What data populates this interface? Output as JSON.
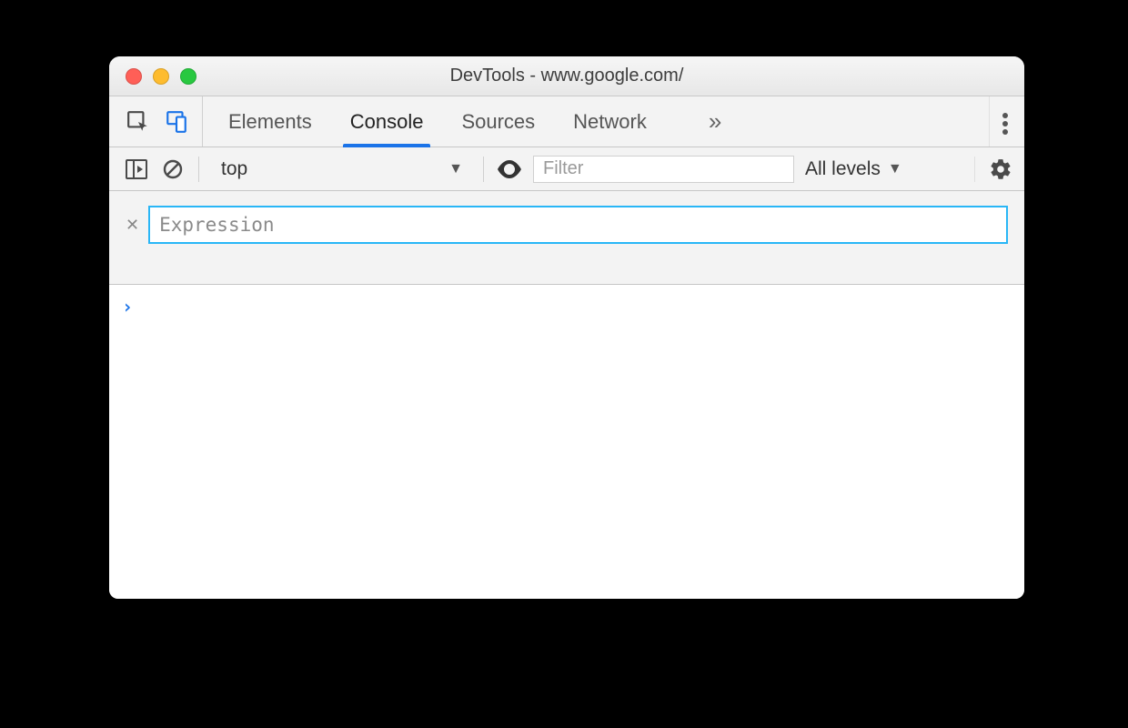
{
  "window": {
    "title": "DevTools - www.google.com/"
  },
  "tabs": {
    "items": [
      "Elements",
      "Console",
      "Sources",
      "Network"
    ],
    "active": "Console",
    "overflow_glyph": "»"
  },
  "toolbar": {
    "context": "top",
    "filter_placeholder": "Filter",
    "levels_label": "All levels"
  },
  "live_expression": {
    "placeholder": "Expression"
  },
  "console": {
    "prompt_glyph": "›"
  }
}
